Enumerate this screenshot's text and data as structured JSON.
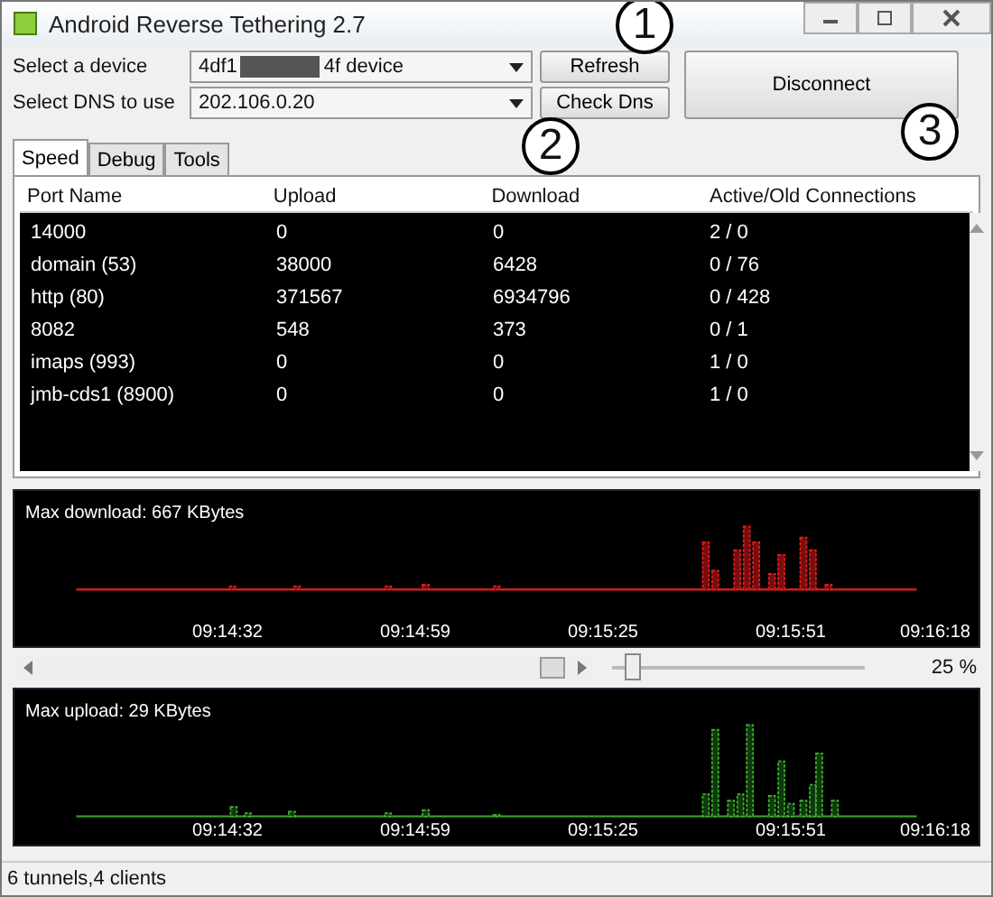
{
  "window": {
    "title": "Android Reverse Tethering 2.7"
  },
  "device": {
    "label": "Select a device",
    "value_start": "4df1",
    "value_end": "4f  device"
  },
  "dns": {
    "label": "Select DNS to use",
    "value": "202.106.0.20"
  },
  "buttons": {
    "refresh": "Refresh",
    "check_dns": "Check Dns",
    "disconnect": "Disconnect"
  },
  "callouts": [
    "1",
    "2",
    "3"
  ],
  "tabs": [
    {
      "label": "Speed",
      "selected": true
    },
    {
      "label": "Debug",
      "selected": false
    },
    {
      "label": "Tools",
      "selected": false
    }
  ],
  "table": {
    "columns": [
      "Port Name",
      "Upload",
      "Download",
      "Active/Old Connections"
    ],
    "rows": [
      [
        "14000",
        "0",
        "0",
        "2 / 0"
      ],
      [
        "domain (53)",
        "38000",
        "6428",
        "0 / 76"
      ],
      [
        "http (80)",
        "371567",
        "6934796",
        "0 / 428"
      ],
      [
        "8082",
        "548",
        "373",
        "0 / 1"
      ],
      [
        "imaps (993)",
        "0",
        "0",
        "1 / 0"
      ],
      [
        "jmb-cds1 (8900)",
        "0",
        "0",
        "1 / 0"
      ]
    ]
  },
  "download_graph": {
    "title": "Max download: 667 KBytes",
    "times": [
      "09:14:32",
      "09:14:59",
      "09:15:25",
      "09:15:51",
      "09:16:18"
    ]
  },
  "zoom": {
    "level": 0.05,
    "reading": "25 %"
  },
  "upload_graph": {
    "title": "Max upload: 29 KBytes",
    "times": [
      "09:14:32",
      "09:14:59",
      "09:15:25",
      "09:15:51",
      "09:16:18"
    ]
  },
  "status_bar": "6 tunnels,4 clients"
}
